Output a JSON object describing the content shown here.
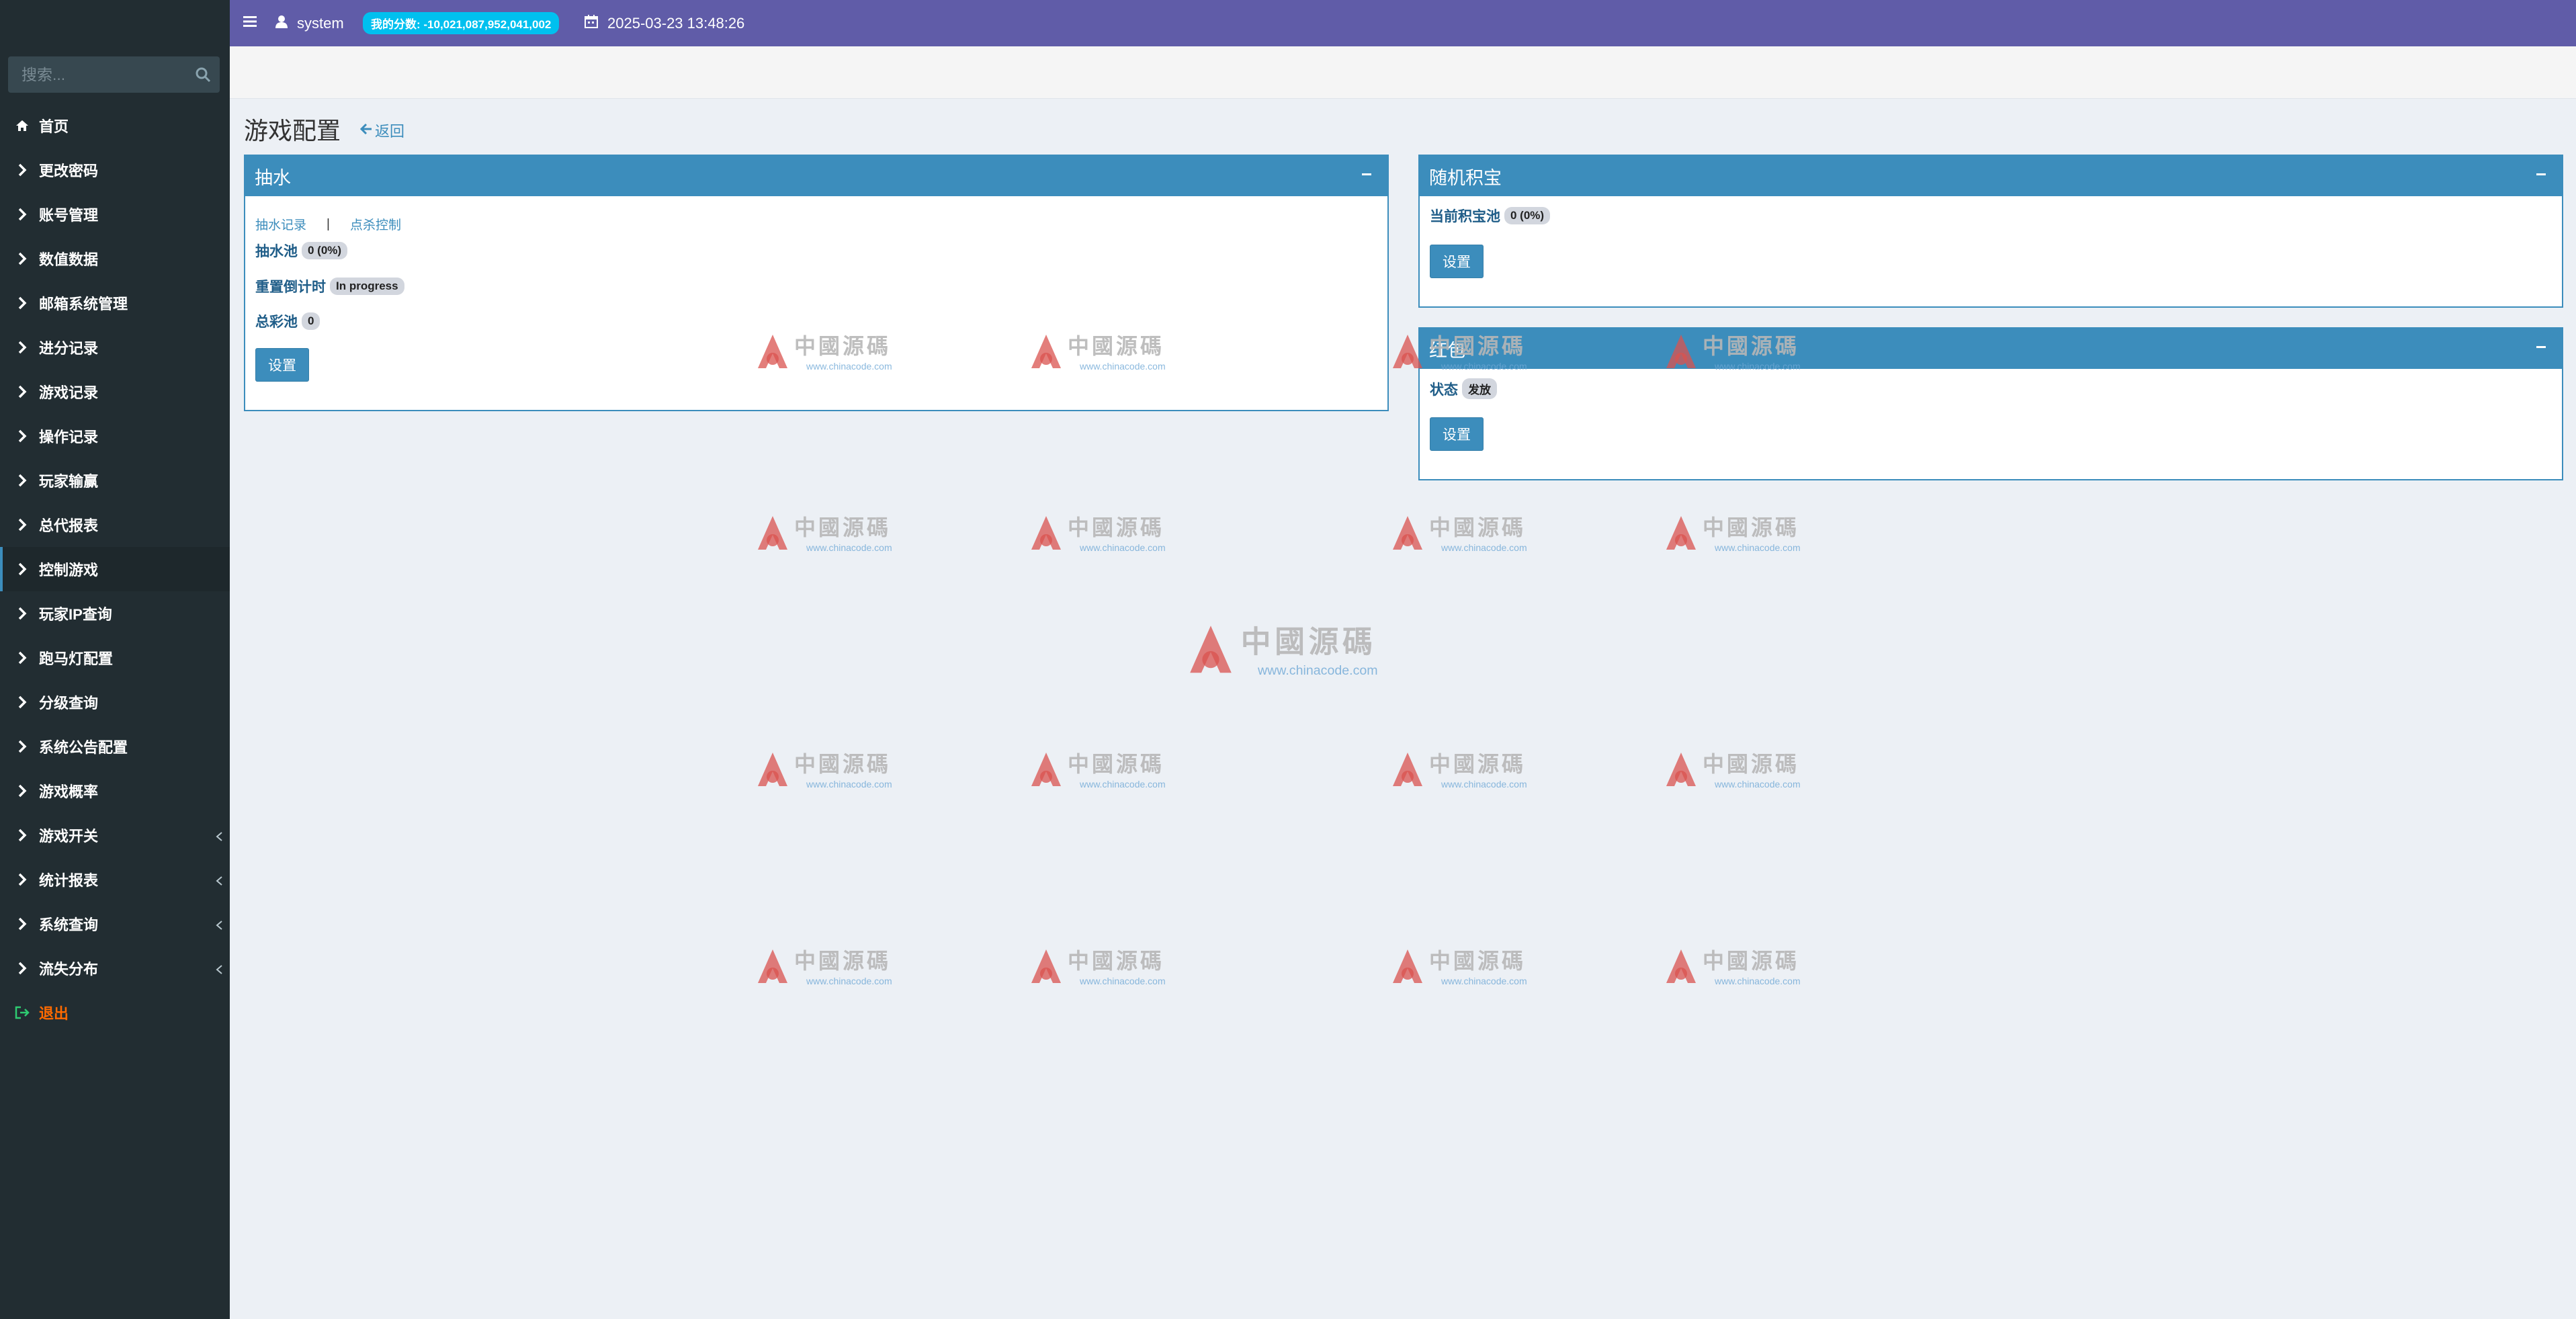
{
  "header": {
    "user": "system",
    "score_label": "我的分数: -10,021,087,952,041,002",
    "datetime": "2025-03-23 13:48:26"
  },
  "search": {
    "placeholder": "搜索..."
  },
  "sidebar": {
    "items": [
      {
        "label": "首页",
        "icon": "home-icon"
      },
      {
        "label": "更改密码",
        "icon": "chevron-right-icon"
      },
      {
        "label": "账号管理",
        "icon": "chevron-right-icon"
      },
      {
        "label": "数值数据",
        "icon": "chevron-right-icon"
      },
      {
        "label": "邮箱系统管理",
        "icon": "chevron-right-icon"
      },
      {
        "label": "进分记录",
        "icon": "chevron-right-icon"
      },
      {
        "label": "游戏记录",
        "icon": "chevron-right-icon"
      },
      {
        "label": "操作记录",
        "icon": "chevron-right-icon"
      },
      {
        "label": "玩家输赢",
        "icon": "chevron-right-icon"
      },
      {
        "label": "总代报表",
        "icon": "chevron-right-icon"
      },
      {
        "label": "控制游戏",
        "icon": "chevron-right-icon",
        "active": true
      },
      {
        "label": "玩家IP查询",
        "icon": "chevron-right-icon"
      },
      {
        "label": "跑马灯配置",
        "icon": "chevron-right-icon"
      },
      {
        "label": "分级查询",
        "icon": "chevron-right-icon"
      },
      {
        "label": "系统公告配置",
        "icon": "chevron-right-icon"
      },
      {
        "label": "游戏概率",
        "icon": "chevron-right-icon"
      },
      {
        "label": "游戏开关",
        "icon": "chevron-right-icon",
        "expandable": true
      },
      {
        "label": "统计报表",
        "icon": "chevron-right-icon",
        "expandable": true
      },
      {
        "label": "系统查询",
        "icon": "chevron-right-icon",
        "expandable": true
      },
      {
        "label": "流失分布",
        "icon": "chevron-right-icon",
        "expandable": true
      },
      {
        "label": "退出",
        "icon": "sign-out-icon"
      }
    ]
  },
  "page": {
    "title": "游戏配置",
    "back_label": "返回"
  },
  "pump_box": {
    "title": "抽水",
    "link_records": "抽水记录",
    "separator": "|",
    "link_control": "点杀控制",
    "pool_label": "抽水池",
    "pool_value": "0 (0%)",
    "reset_label": "重置倒计时",
    "reset_value": "In progress",
    "jackpot_label": "总彩池",
    "jackpot_value": "0",
    "button": "设置"
  },
  "treasure_box": {
    "title": "随机积宝",
    "pool_label": "当前积宝池",
    "pool_value": "0 (0%)",
    "button": "设置"
  },
  "redpacket_box": {
    "title": "红包",
    "status_label": "状态",
    "status_value": "发放",
    "button": "设置"
  },
  "watermark": {
    "text": "中國源碼",
    "url": "www.chinacode.com"
  },
  "colors": {
    "header": "#605ca8",
    "sidebar": "#222d32",
    "primary": "#3c8dbc",
    "score_badge": "#00c0ef",
    "logout": "#ff6a00"
  }
}
